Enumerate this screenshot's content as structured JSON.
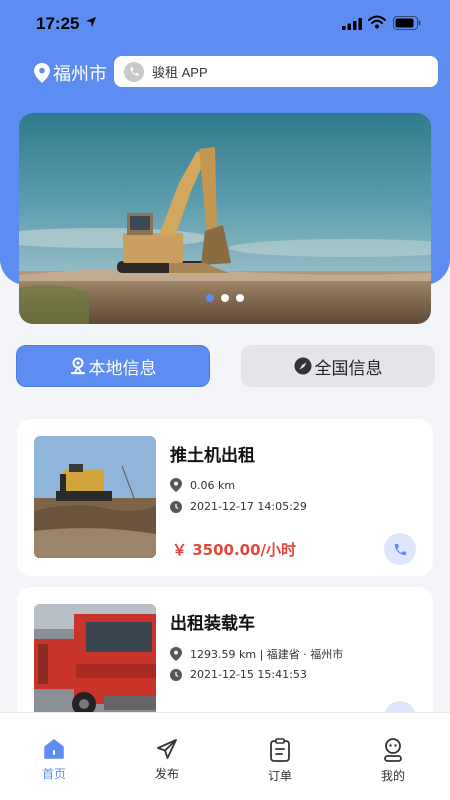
{
  "status_bar": {
    "time": "17:25"
  },
  "header": {
    "city": "福州市",
    "search_text": "骏租 APP"
  },
  "banner": {
    "dots": 3,
    "active_dot": 0
  },
  "segments": {
    "local": "本地信息",
    "national": "全国信息",
    "active": "local"
  },
  "listings": [
    {
      "title": "推土机出租",
      "distance": "0.06 km",
      "time": "2021-12-17 14:05:29",
      "price": "￥ 3500.00/小时"
    },
    {
      "title": "出租装载车",
      "distance": "1293.59 km | 福建省 · 福州市",
      "time": "2021-12-15 15:41:53"
    }
  ],
  "tabbar": {
    "items": [
      {
        "label": "首页",
        "icon": "home-icon"
      },
      {
        "label": "发布",
        "icon": "send-icon"
      },
      {
        "label": "订单",
        "icon": "clipboard-icon"
      },
      {
        "label": "我的",
        "icon": "user-icon"
      }
    ],
    "active_index": 0
  },
  "colors": {
    "primary": "#5d8df0",
    "price": "#e2483a",
    "background": "#f4f5f9"
  }
}
